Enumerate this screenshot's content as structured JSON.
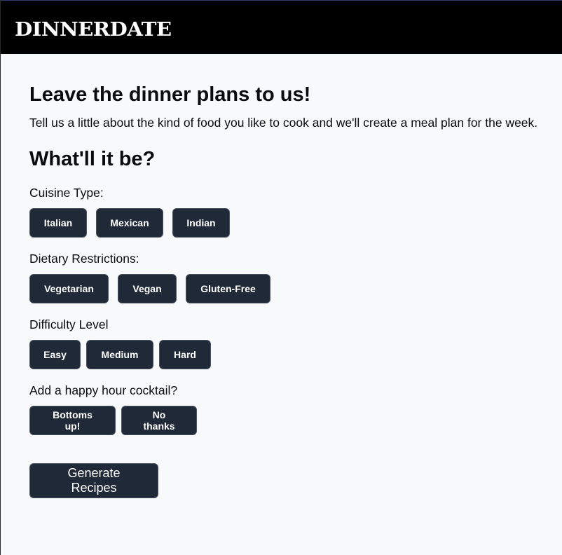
{
  "header": {
    "logo_text": "DINNERDATE"
  },
  "main": {
    "title": "Leave the dinner plans to us!",
    "intro": "Tell us a little about the kind of food you like to cook and we'll create a meal plan for the week.",
    "section_title": "What'll it be?",
    "groups": [
      {
        "label": "Cuisine Type:",
        "options": [
          "Italian",
          "Mexican",
          "Indian"
        ]
      },
      {
        "label": "Dietary Restrictions:",
        "options": [
          "Vegetarian",
          "Vegan",
          "Gluten-Free"
        ]
      },
      {
        "label": "Difficulty Level",
        "options": [
          "Easy",
          "Medium",
          "Hard"
        ]
      },
      {
        "label": "Add a happy hour cocktail?",
        "options": [
          "Bottoms up!",
          "No thanks"
        ]
      }
    ],
    "generate_label": "Generate Recipes"
  },
  "colors": {
    "header_bg": "#000000",
    "page_bg": "#f8f9fb",
    "button_bg": "#1f2937",
    "button_text": "#ffffff"
  }
}
